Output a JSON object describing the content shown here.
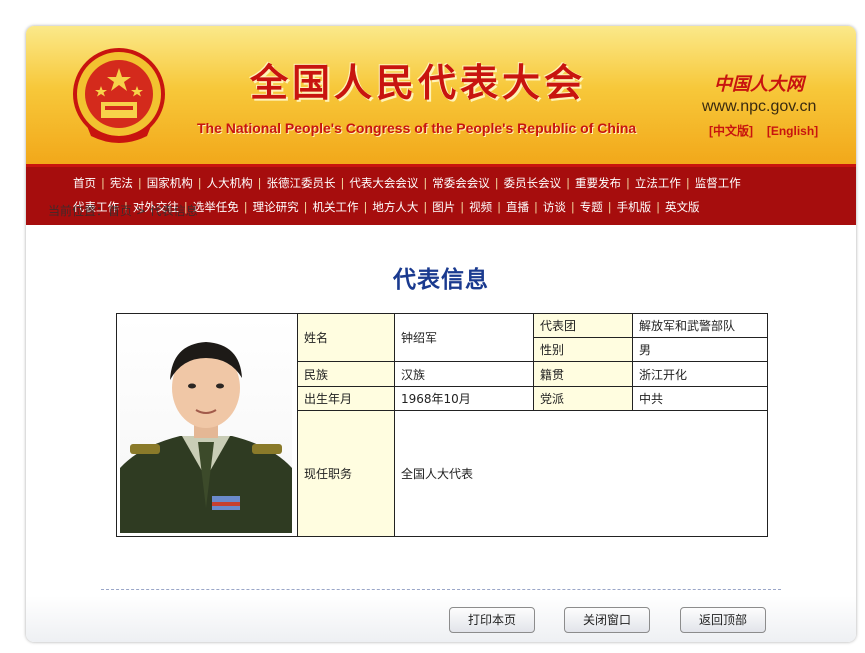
{
  "header": {
    "title_cn": "全国人民代表大会",
    "title_en": "The National People's Congress of the People's Republic of China",
    "brand_logo": "中国人大网",
    "brand_url": "www.npc.gov.cn",
    "lang_cn": "[中文版]",
    "lang_en": "[English]",
    "emblem": "national-emblem-icon",
    "colors": {
      "red": "#c8140f",
      "gold": "#f7c83a",
      "nav_red": "#a60d0d",
      "heading_blue": "#1a3a8f"
    }
  },
  "nav": {
    "row1": [
      "首页",
      "宪法",
      "国家机构",
      "人大机构",
      "张德江委员长",
      "代表大会会议",
      "常委会会议",
      "委员长会议",
      "重要发布",
      "立法工作",
      "监督工作"
    ],
    "row2": [
      "代表工作",
      "对外交往",
      "选举任免",
      "理论研究",
      "机关工作",
      "地方人大",
      "图片",
      "视频",
      "直播",
      "访谈",
      "专题",
      "手机版",
      "英文版"
    ]
  },
  "breadcrumb": "当前位置：首页 > 代表信息",
  "main": {
    "heading": "代表信息",
    "photo": "delegate-portrait",
    "fields": {
      "name_label": "姓名",
      "name_value": "钟绍军",
      "delegation_label": "代表团",
      "delegation_value": "解放军和武警部队",
      "gender_label": "性别",
      "gender_value": "男",
      "ethnicity_label": "民族",
      "ethnicity_value": "汉族",
      "native_label": "籍贯",
      "native_value": "浙江开化",
      "birth_label": "出生年月",
      "birth_value": "1968年10月",
      "party_label": "党派",
      "party_value": "中共",
      "position_label": "现任职务",
      "position_value": "全国人大代表"
    }
  },
  "footer": {
    "print": "打印本页",
    "close": "关闭窗口",
    "top": "返回顶部"
  }
}
